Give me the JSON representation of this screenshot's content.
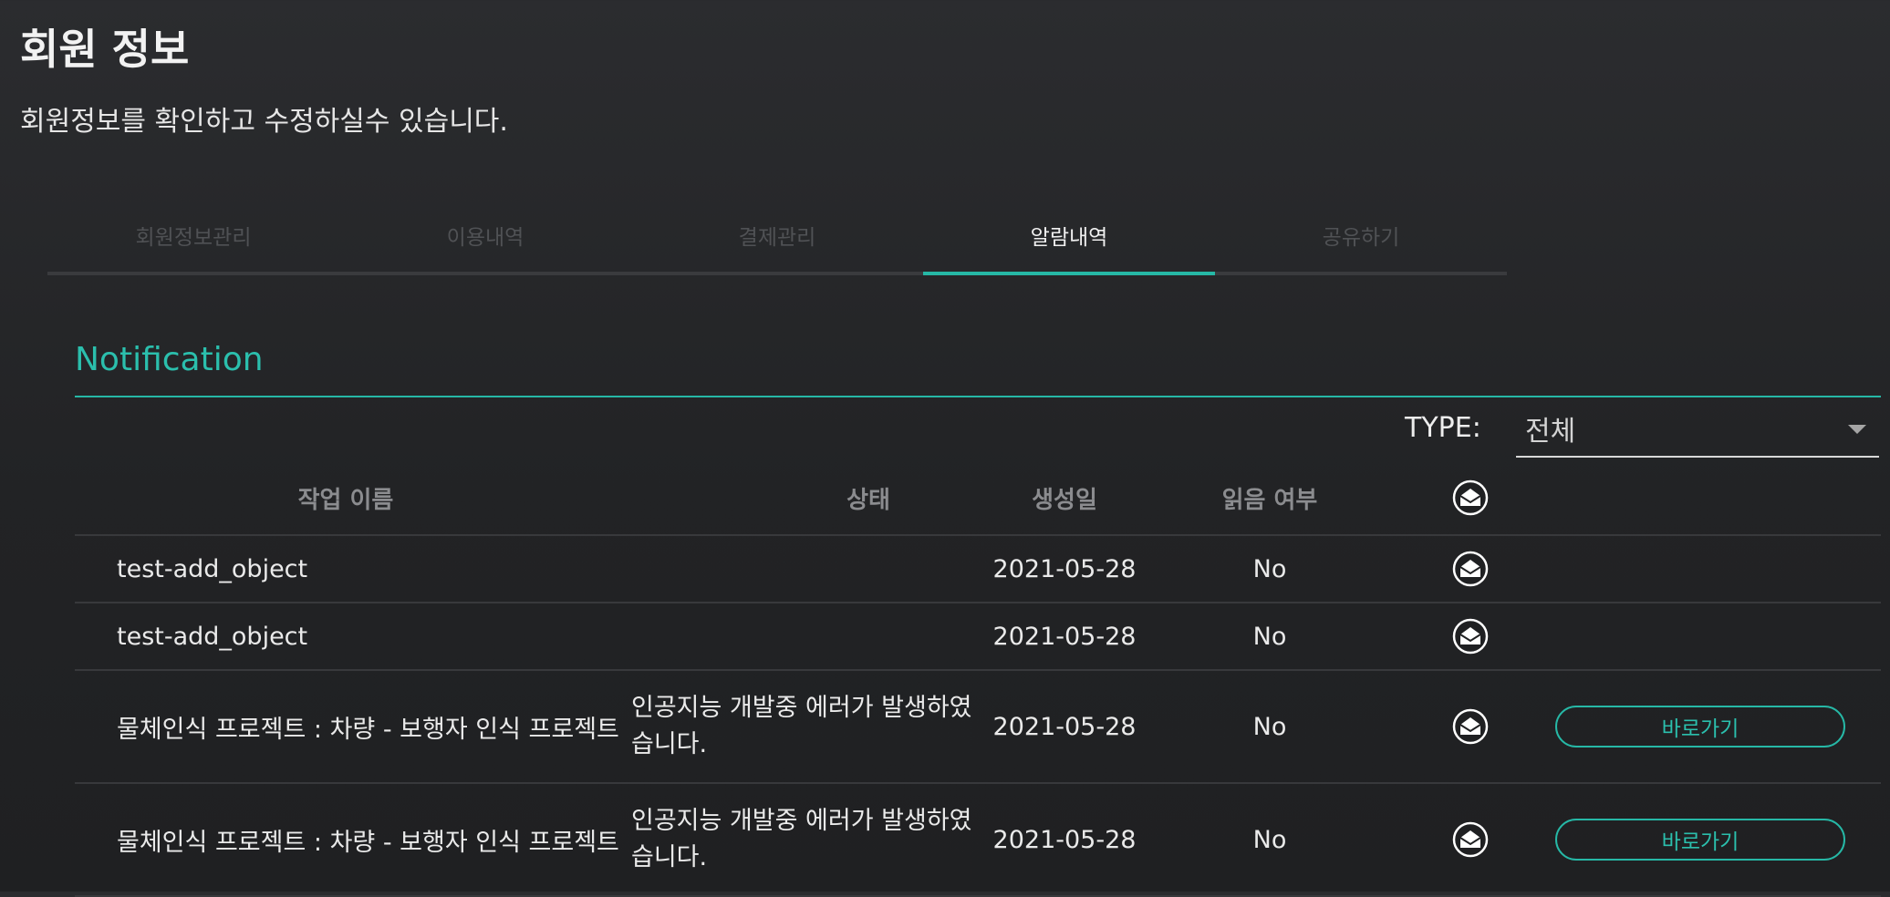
{
  "header": {
    "title": "회원 정보",
    "subtitle": "회원정보를 확인하고 수정하실수 있습니다."
  },
  "tabs": [
    {
      "label": "회원정보관리",
      "active": false
    },
    {
      "label": "이용내역",
      "active": false
    },
    {
      "label": "결제관리",
      "active": false
    },
    {
      "label": "알람내역",
      "active": true
    },
    {
      "label": "공유하기",
      "active": false
    }
  ],
  "section": {
    "title": "Notification"
  },
  "filter": {
    "label": "TYPE:",
    "selected": "전체"
  },
  "table": {
    "columns": {
      "name": "작업 이름",
      "status": "상태",
      "created": "생성일",
      "read": "읽음 여부",
      "mail_icon": "mail-open-icon"
    },
    "rows": [
      {
        "name": "test-add_object",
        "status": "",
        "created": "2021-05-28",
        "read": "No",
        "action": ""
      },
      {
        "name": "test-add_object",
        "status": "",
        "created": "2021-05-28",
        "read": "No",
        "action": ""
      },
      {
        "name": "물체인식 프로젝트 : 차량 - 보행자 인식 프로젝트",
        "status": "인공지능 개발중 에러가 발생하였습니다.",
        "created": "2021-05-28",
        "read": "No",
        "action": "바로가기"
      },
      {
        "name": "물체인식 프로젝트 : 차량 - 보행자 인식 프로젝트",
        "status": "인공지능 개발중 에러가 발생하였습니다.",
        "created": "2021-05-28",
        "read": "No",
        "action": "바로가기"
      }
    ]
  },
  "colors": {
    "accent": "#26b8a6",
    "background": "#232427",
    "muted_tab": "#505255",
    "header_text": "#8b8c8f"
  }
}
